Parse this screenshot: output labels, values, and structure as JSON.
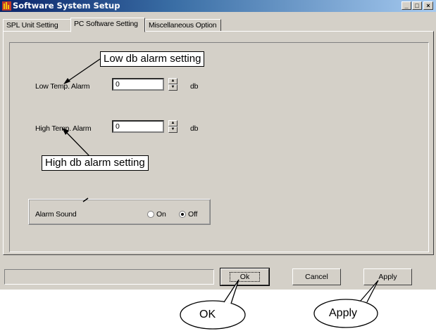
{
  "window": {
    "title": "Software System Setup",
    "controls": [
      "_",
      "□",
      "×"
    ]
  },
  "tabs": [
    {
      "label": "SPL Unit Setting"
    },
    {
      "label": "PC Software Setting"
    },
    {
      "label": "Miscellaneous Option"
    }
  ],
  "form": {
    "low_label": "Low Temp. Alarm",
    "low_value": "0",
    "low_unit": "db",
    "high_label": "High Temp. Alarm",
    "high_value": "0",
    "high_unit": "db",
    "alarm_sound_label": "Alarm Sound",
    "radio_on_label": "On",
    "radio_off_label": "Off",
    "alarm_sound_selected": "Off"
  },
  "buttons": {
    "ok": "Ok",
    "cancel": "Cancel",
    "apply": "Apply"
  },
  "annotations": {
    "low_callout": "Low db alarm setting",
    "high_callout": "High db alarm setting",
    "ok_bubble": "OK",
    "apply_bubble": "Apply"
  },
  "icons": {
    "app": "app-icon",
    "spin_up": "spin-up-icon",
    "spin_down": "spin-down-icon"
  }
}
